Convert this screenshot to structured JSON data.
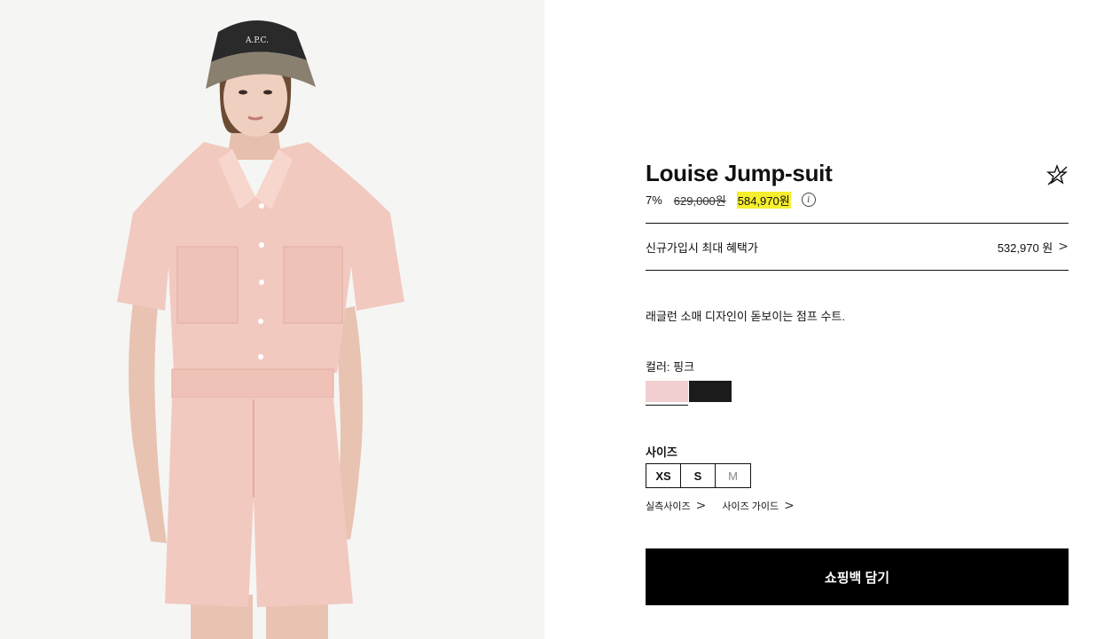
{
  "product": {
    "title": "Louise Jump-suit",
    "discount": "7%",
    "original_price": "629,000원",
    "sale_price": "584,970원",
    "info_icon": "info-icon",
    "wishlist_icon": "star-icon"
  },
  "benefit": {
    "label": "신규가입시 최대 혜택가",
    "value": "532,970 원",
    "chevron": ">"
  },
  "description": "래글런 소매 디자인이 돋보이는 점프 수트.",
  "color": {
    "label": "컬러: 핑크",
    "options": [
      {
        "name": "pink",
        "hex": "#f1cfd0",
        "selected": true
      },
      {
        "name": "black",
        "hex": "#1b1b1b",
        "selected": false
      }
    ]
  },
  "size": {
    "label": "사이즈",
    "options": [
      {
        "label": "XS",
        "available": true
      },
      {
        "label": "S",
        "available": true
      },
      {
        "label": "M",
        "available": false
      }
    ]
  },
  "links": {
    "measured_size": "실측사이즈",
    "size_guide": "사이즈 가이드",
    "chevron": ">"
  },
  "cart_button": "쇼핑백 담기",
  "colors": {
    "highlight": "#f5ef2e",
    "button_bg": "#000000",
    "photo_bg": "#f5f5f4",
    "jumpsuit": "#f2c9bf"
  }
}
